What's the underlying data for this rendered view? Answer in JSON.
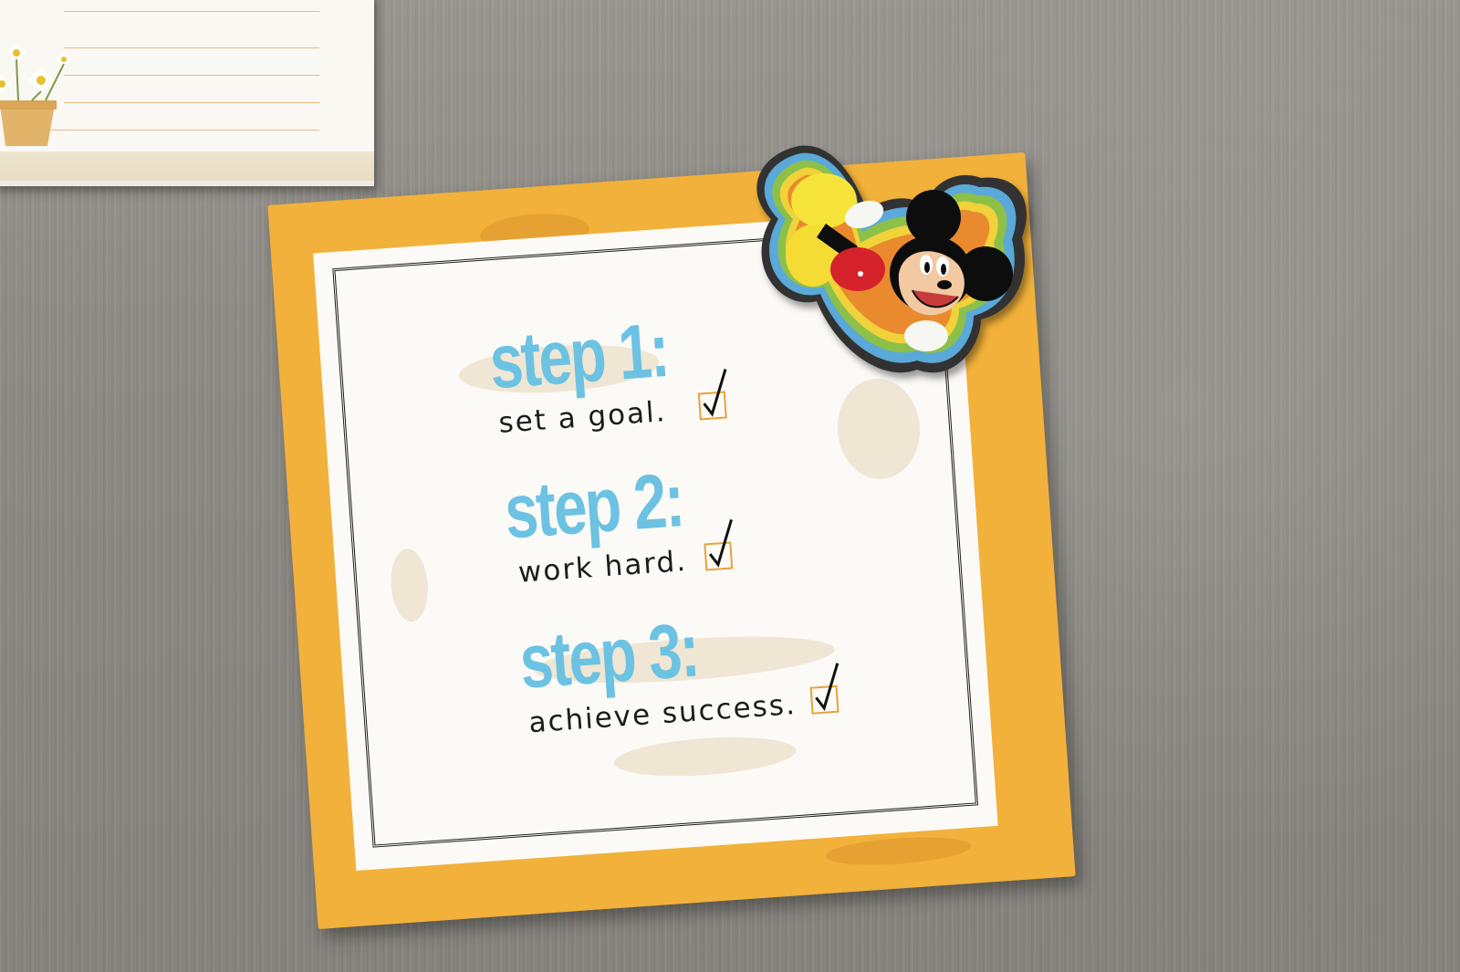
{
  "scene": {
    "description_surface": "",
    "background_color": "#8f8c86"
  },
  "card": {
    "steps": [
      {
        "title": "step 1:",
        "text": "set a goal."
      },
      {
        "title": "step 2:",
        "text": "work hard."
      },
      {
        "title": "step 3:",
        "text": "achieve success."
      }
    ],
    "colors": {
      "border": "#f2b13a",
      "title": "#6cc2e2",
      "checkbox": "#e8a23a"
    }
  },
  "icons": {
    "checkmark": "checkmark-icon",
    "magnet": "mickey-mouse-magnet-icon",
    "flowers": "daisy-flower-pot-icon"
  }
}
